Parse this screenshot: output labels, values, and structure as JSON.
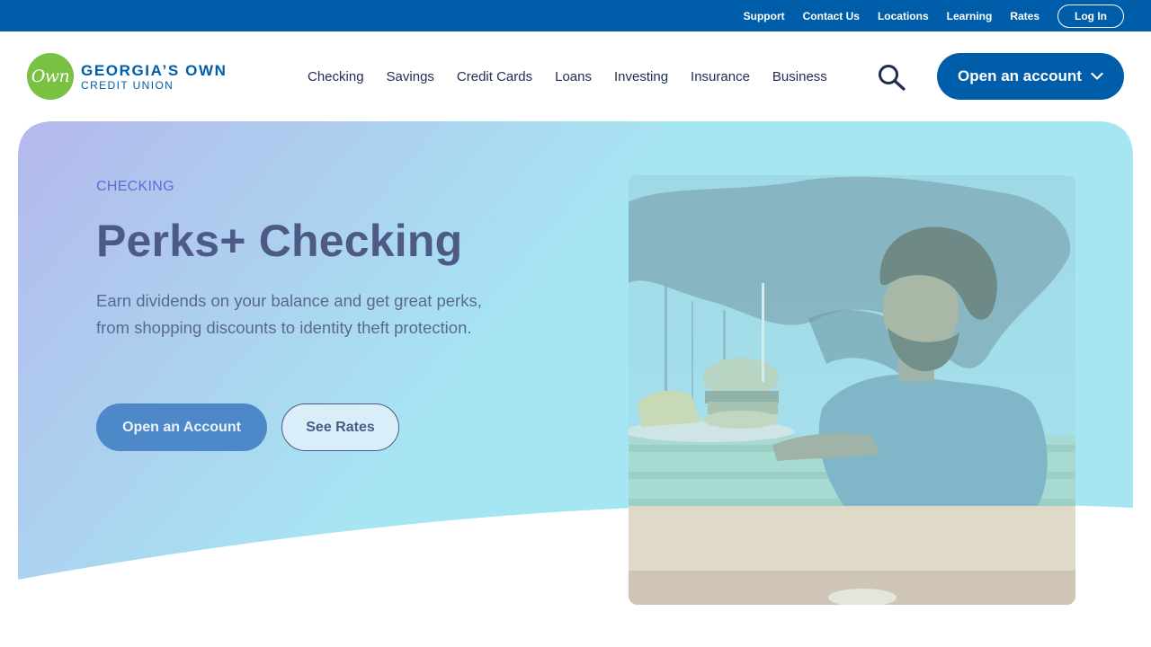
{
  "utility_nav": {
    "links": [
      "Support",
      "Contact Us",
      "Locations",
      "Learning",
      "Rates"
    ],
    "login_label": "Log In"
  },
  "brand": {
    "mark_text": "Own",
    "name_line1": "GEORGIA’S OWN",
    "name_line2": "CREDIT UNION",
    "primary_color": "#005daa",
    "logo_color": "#78c142"
  },
  "main_nav": {
    "items": [
      "Checking",
      "Savings",
      "Credit Cards",
      "Loans",
      "Investing",
      "Insurance",
      "Business"
    ],
    "search_icon": "search-icon",
    "cta_label": "Open an account",
    "cta_icon": "chevron-down-icon"
  },
  "hero": {
    "eyebrow": "CHECKING",
    "title": "Perks+ Checking",
    "description": "Earn dividends on your balance and get great perks, from shopping discounts to identity theft protection.",
    "primary_button": "Open an Account",
    "secondary_button": "See Rates",
    "gradient_start": "#b4b8ec",
    "gradient_end": "#a6e6f2"
  }
}
